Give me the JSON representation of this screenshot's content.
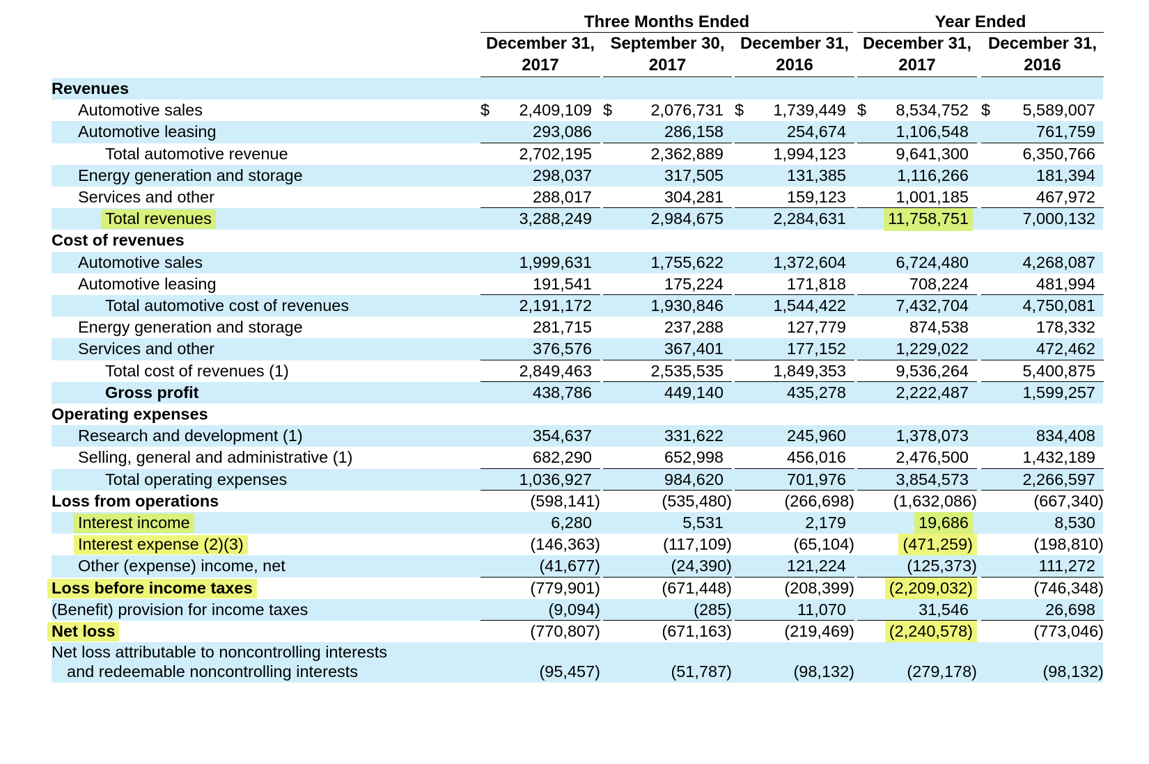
{
  "header": {
    "group_three_months": "Three Months Ended",
    "group_year": "Year Ended",
    "columns": [
      {
        "line1": "December 31,",
        "line2": "2017"
      },
      {
        "line1": "September 30,",
        "line2": "2017"
      },
      {
        "line1": "December 31,",
        "line2": "2016"
      },
      {
        "line1": "December 31,",
        "line2": "2017"
      },
      {
        "line1": "December 31,",
        "line2": "2016"
      }
    ]
  },
  "currency_symbol": "$",
  "rows": [
    {
      "label": "Revenues",
      "indent": 0,
      "bold": true,
      "shaded": true,
      "values": []
    },
    {
      "label": "Automotive sales",
      "indent": 1,
      "shaded": false,
      "dollar": true,
      "values": [
        "2,409,109",
        "2,076,731",
        "1,739,449",
        "8,534,752",
        "5,589,007"
      ]
    },
    {
      "label": "Automotive leasing",
      "indent": 1,
      "shaded": true,
      "underline": true,
      "values": [
        "293,086",
        "286,158",
        "254,674",
        "1,106,548",
        "761,759"
      ]
    },
    {
      "label": "Total automotive revenue",
      "indent": 2,
      "shaded": false,
      "values": [
        "2,702,195",
        "2,362,889",
        "1,994,123",
        "9,641,300",
        "6,350,766"
      ]
    },
    {
      "label": "Energy generation and storage",
      "indent": 1,
      "shaded": true,
      "values": [
        "298,037",
        "317,505",
        "131,385",
        "1,116,266",
        "181,394"
      ]
    },
    {
      "label": "Services and other",
      "indent": 1,
      "shaded": false,
      "underline": true,
      "values": [
        "288,017",
        "304,281",
        "159,123",
        "1,001,185",
        "467,972"
      ]
    },
    {
      "label": "Total revenues",
      "indent": 2,
      "shaded": true,
      "label_highlight": "green",
      "highlight_cols": [
        3
      ],
      "highlight_color": "green",
      "values": [
        "3,288,249",
        "2,984,675",
        "2,284,631",
        "11,758,751",
        "7,000,132"
      ]
    },
    {
      "label": "Cost of revenues",
      "indent": 0,
      "bold": true,
      "shaded": false,
      "values": []
    },
    {
      "label": "Automotive sales",
      "indent": 1,
      "shaded": true,
      "values": [
        "1,999,631",
        "1,755,622",
        "1,372,604",
        "6,724,480",
        "4,268,087"
      ]
    },
    {
      "label": "Automotive leasing",
      "indent": 1,
      "shaded": false,
      "underline": true,
      "values": [
        "191,541",
        "175,224",
        "171,818",
        "708,224",
        "481,994"
      ]
    },
    {
      "label": "Total automotive cost of revenues",
      "indent": 2,
      "shaded": true,
      "values": [
        "2,191,172",
        "1,930,846",
        "1,544,422",
        "7,432,704",
        "4,750,081"
      ]
    },
    {
      "label": "Energy generation and storage",
      "indent": 1,
      "shaded": false,
      "values": [
        "281,715",
        "237,288",
        "127,779",
        "874,538",
        "178,332"
      ]
    },
    {
      "label": "Services and other",
      "indent": 1,
      "shaded": true,
      "underline": true,
      "values": [
        "376,576",
        "367,401",
        "177,152",
        "1,229,022",
        "472,462"
      ]
    },
    {
      "label": "Total cost of revenues (1)",
      "indent": 2,
      "shaded": false,
      "underline": true,
      "values": [
        "2,849,463",
        "2,535,535",
        "1,849,353",
        "9,536,264",
        "5,400,875"
      ]
    },
    {
      "label": "Gross profit",
      "indent": 2,
      "bold": true,
      "shaded": true,
      "values": [
        "438,786",
        "449,140",
        "435,278",
        "2,222,487",
        "1,599,257"
      ]
    },
    {
      "label": "Operating expenses",
      "indent": 0,
      "bold": true,
      "shaded": false,
      "values": []
    },
    {
      "label": "Research and development (1)",
      "indent": 1,
      "shaded": true,
      "values": [
        "354,637",
        "331,622",
        "245,960",
        "1,378,073",
        "834,408"
      ]
    },
    {
      "label": "Selling, general and administrative (1)",
      "indent": 1,
      "shaded": false,
      "underline": true,
      "values": [
        "682,290",
        "652,998",
        "456,016",
        "2,476,500",
        "1,432,189"
      ]
    },
    {
      "label": "Total operating expenses",
      "indent": 2,
      "shaded": true,
      "underline": true,
      "values": [
        "1,036,927",
        "984,620",
        "701,976",
        "3,854,573",
        "2,266,597"
      ]
    },
    {
      "label": "Loss from operations",
      "indent": 0,
      "bold": true,
      "shaded": false,
      "values": [
        "(598,141)",
        "(535,480)",
        "(266,698)",
        "(1,632,086)",
        "(667,340)"
      ]
    },
    {
      "label": "Interest income",
      "indent": 1,
      "shaded": true,
      "label_highlight": "green",
      "highlight_cols": [
        3
      ],
      "highlight_color": "green",
      "values": [
        "6,280",
        "5,531",
        "2,179",
        "19,686",
        "8,530"
      ]
    },
    {
      "label": "Interest expense (2)(3)",
      "indent": 1,
      "shaded": false,
      "label_highlight": "yellow",
      "highlight_cols": [
        3
      ],
      "highlight_color": "yellow",
      "values": [
        "(146,363)",
        "(117,109)",
        "(65,104)",
        "(471,259)",
        "(198,810)"
      ]
    },
    {
      "label": "Other (expense) income, net",
      "indent": 1,
      "shaded": true,
      "underline": true,
      "values": [
        "(41,677)",
        "(24,390)",
        "121,224",
        "(125,373)",
        "111,272"
      ]
    },
    {
      "label": "Loss before income taxes",
      "indent": 0,
      "bold": true,
      "shaded": false,
      "label_highlight": "yellow",
      "highlight_cols": [
        3
      ],
      "highlight_color": "yellow",
      "values": [
        "(779,901)",
        "(671,448)",
        "(208,399)",
        "(2,209,032)",
        "(746,348)"
      ]
    },
    {
      "label": "(Benefit) provision for income taxes",
      "indent": 0,
      "shaded": true,
      "underline": true,
      "values": [
        "(9,094)",
        "(285)",
        "11,070",
        "31,546",
        "26,698"
      ]
    },
    {
      "label": "Net loss",
      "indent": 0,
      "bold": true,
      "shaded": false,
      "label_highlight": "yellow",
      "highlight_cols": [
        3
      ],
      "highlight_color": "yellow",
      "values": [
        "(770,807)",
        "(671,163)",
        "(219,469)",
        "(2,240,578)",
        "(773,046)"
      ]
    },
    {
      "label": "Net loss attributable to noncontrolling interests",
      "label2": "and redeemable noncontrolling interests",
      "indent": 0,
      "shaded": true,
      "two_line": true,
      "values": [
        "(95,457)",
        "(51,787)",
        "(98,132)",
        "(279,178)",
        "(98,132)"
      ]
    }
  ]
}
